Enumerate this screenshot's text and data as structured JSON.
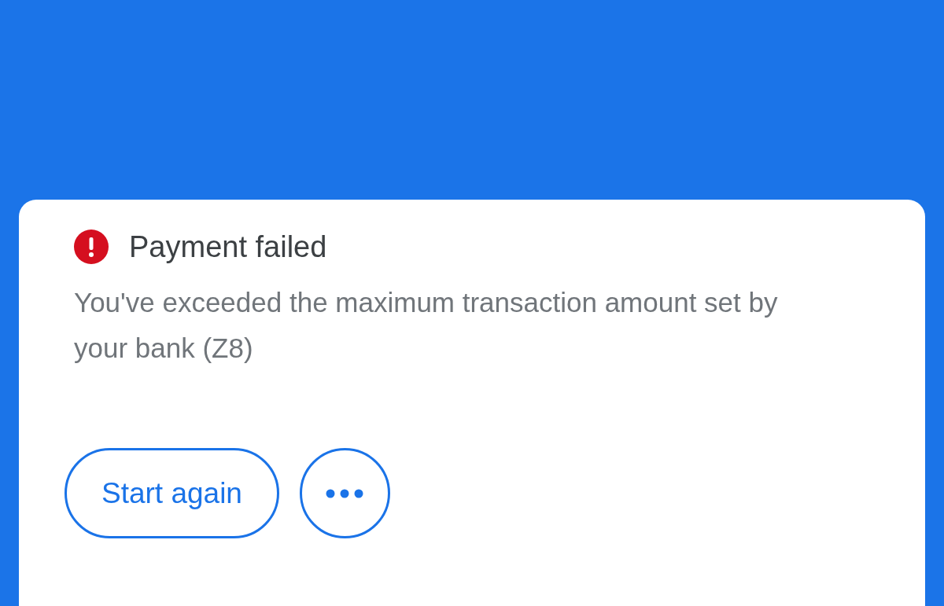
{
  "dialog": {
    "error": true,
    "title": "Payment failed",
    "message": "You've exceeded the maximum transaction amount set by your bank (Z8)",
    "actions": [
      {
        "kind": "text",
        "label": "Start again"
      },
      {
        "kind": "more"
      }
    ]
  }
}
